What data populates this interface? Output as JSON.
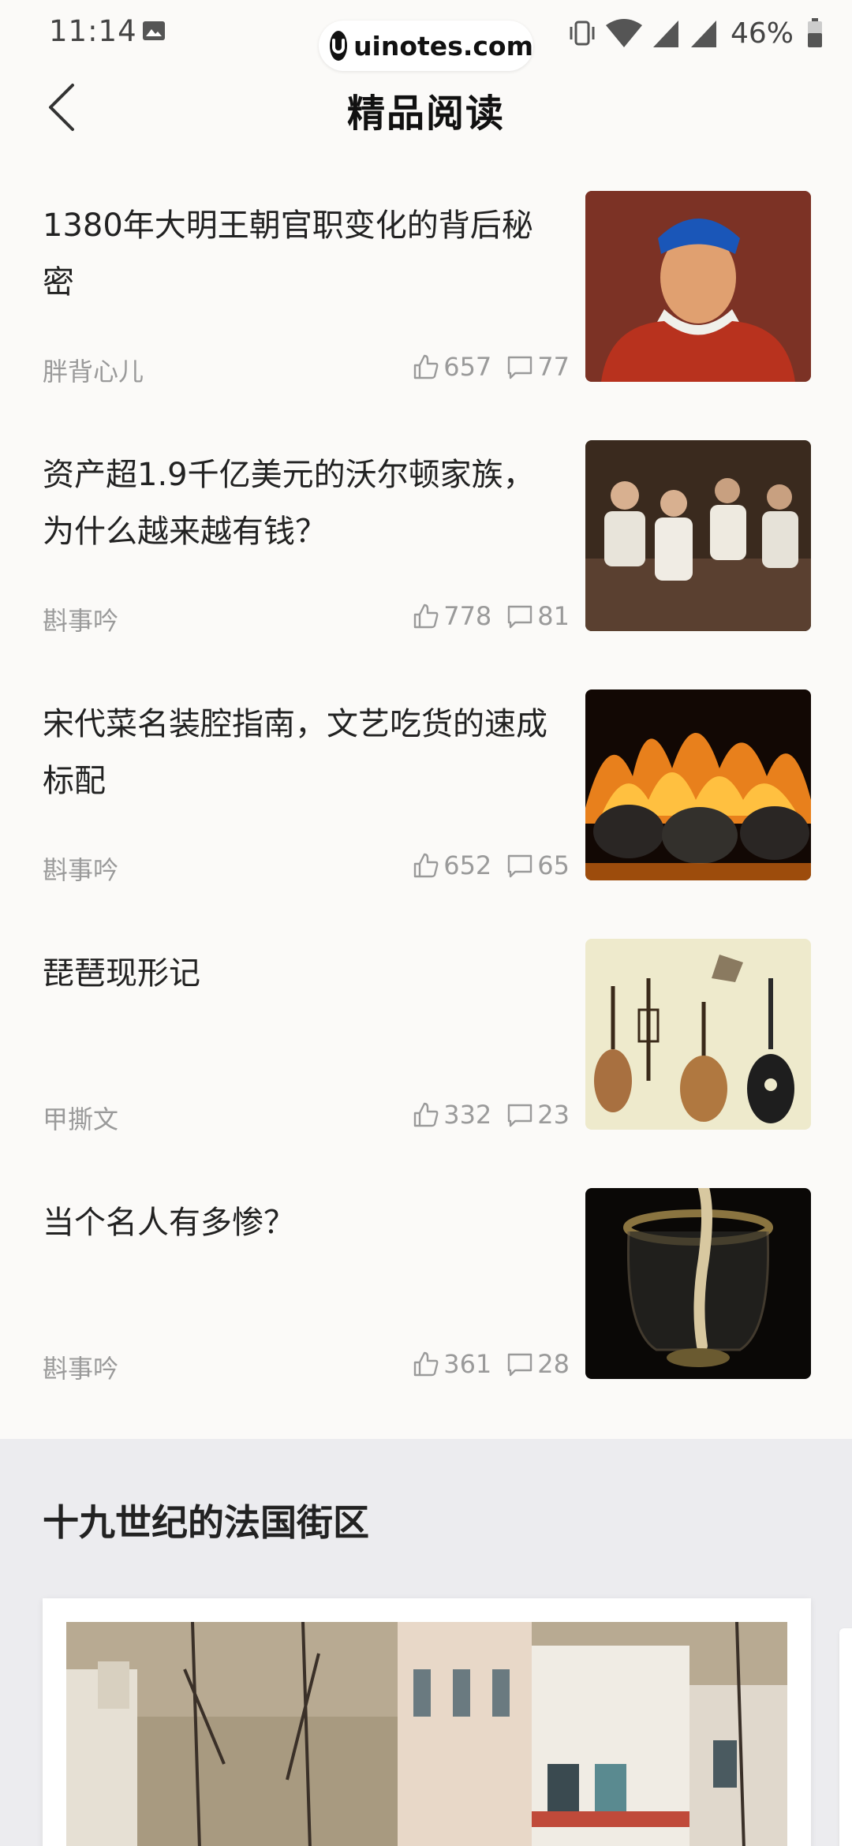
{
  "status_bar": {
    "time": "11:14",
    "battery": "46%",
    "watermark": "uinotes.com"
  },
  "header": {
    "title": "精品阅读"
  },
  "articles": [
    {
      "title": "1380年大明王朝官职变化的背后秘密",
      "author": "胖背心儿",
      "likes": "657",
      "comments": "77",
      "thumbnail": "ming-official-portrait"
    },
    {
      "title": "资产超1.9千亿美元的沃尔顿家族，为什么越来越有钱？",
      "author": "斟事吟",
      "likes": "778",
      "comments": "81",
      "thumbnail": "family-group-photo"
    },
    {
      "title": "宋代菜名装腔指南，文艺吃货的速成标配",
      "author": "斟事吟",
      "likes": "652",
      "comments": "65",
      "thumbnail": "cauldrons-over-fire"
    },
    {
      "title": "琵琶现形记",
      "author": "甲撕文",
      "likes": "332",
      "comments": "23",
      "thumbnail": "string-instruments-on-wall"
    },
    {
      "title": "当个名人有多惨？",
      "author": "斟事吟",
      "likes": "361",
      "comments": "28",
      "thumbnail": "relic-in-glass-vessel"
    }
  ],
  "section": {
    "title": "十九世纪的法国街区",
    "card_image": "french-street-painting"
  },
  "colors": {
    "background": "#fbfaf8",
    "meta_text": "#9a9a9a",
    "section_bg": "#ececef"
  }
}
